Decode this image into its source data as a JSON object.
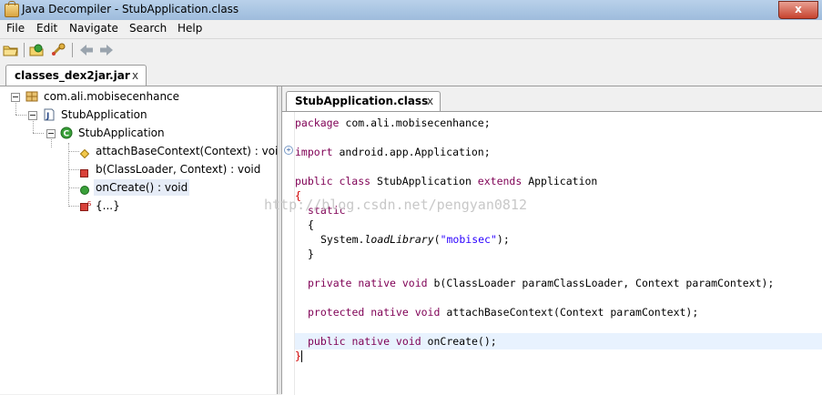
{
  "window": {
    "title": "Java Decompiler - StubApplication.class",
    "close_glyph": "x"
  },
  "menu": [
    "File",
    "Edit",
    "Navigate",
    "Search",
    "Help"
  ],
  "toolbar": {
    "icons": [
      "open-file-icon",
      "open-type-icon",
      "open-type-hierarchy-icon",
      "back-icon",
      "forward-icon"
    ]
  },
  "file_tab": {
    "label": "classes_dex2jar.jar",
    "close": "x"
  },
  "tree": [
    {
      "label": "com.ali.mobisecenhance",
      "icon": "package-icon"
    },
    {
      "label": "StubApplication",
      "icon": "java-file-icon"
    },
    {
      "label": "StubApplication",
      "icon": "class-icon"
    },
    {
      "label": "attachBaseContext(Context) : void",
      "icon": "protected-method-icon"
    },
    {
      "label": "b(ClassLoader, Context) : void",
      "icon": "private-method-icon"
    },
    {
      "label": "onCreate() : void",
      "icon": "public-method-icon"
    },
    {
      "label": "{...}",
      "icon": "static-initializer-icon"
    }
  ],
  "editor": {
    "tab_label": "StubApplication.class",
    "tab_close": "x",
    "fold_marker": "+",
    "code": {
      "l1_kw": "package",
      "l1_rest": " com.ali.mobisecenhance;",
      "l2_kw": "import",
      "l2_rest": " android.app.Application;",
      "l3_kw1": "public class",
      "l3_mid": " StubApplication ",
      "l3_kw2": "extends",
      "l3_rest": " Application",
      "l4": "{",
      "l5_kw": "static",
      "l6": "{",
      "l7_pre": "System.",
      "l7_call": "loadLibrary",
      "l7_open": "(",
      "l7_str": "\"mobisec\"",
      "l7_close": ");",
      "l8": "}",
      "l9_kw": "private native void",
      "l9_rest": " b(ClassLoader paramClassLoader, Context paramContext);",
      "l10_kw": "protected native void",
      "l10_rest": " attachBaseContext(Context paramContext);",
      "l11_kw": "public native void",
      "l11_rest": " onCreate();",
      "l12": "}"
    }
  },
  "watermark": "http://blog.csdn.net/pengyan0812",
  "colors": {
    "keyword": "#7f0055",
    "string": "#2a00ff",
    "title_bar": "#b9d1ea",
    "close_button": "#c7432e"
  }
}
